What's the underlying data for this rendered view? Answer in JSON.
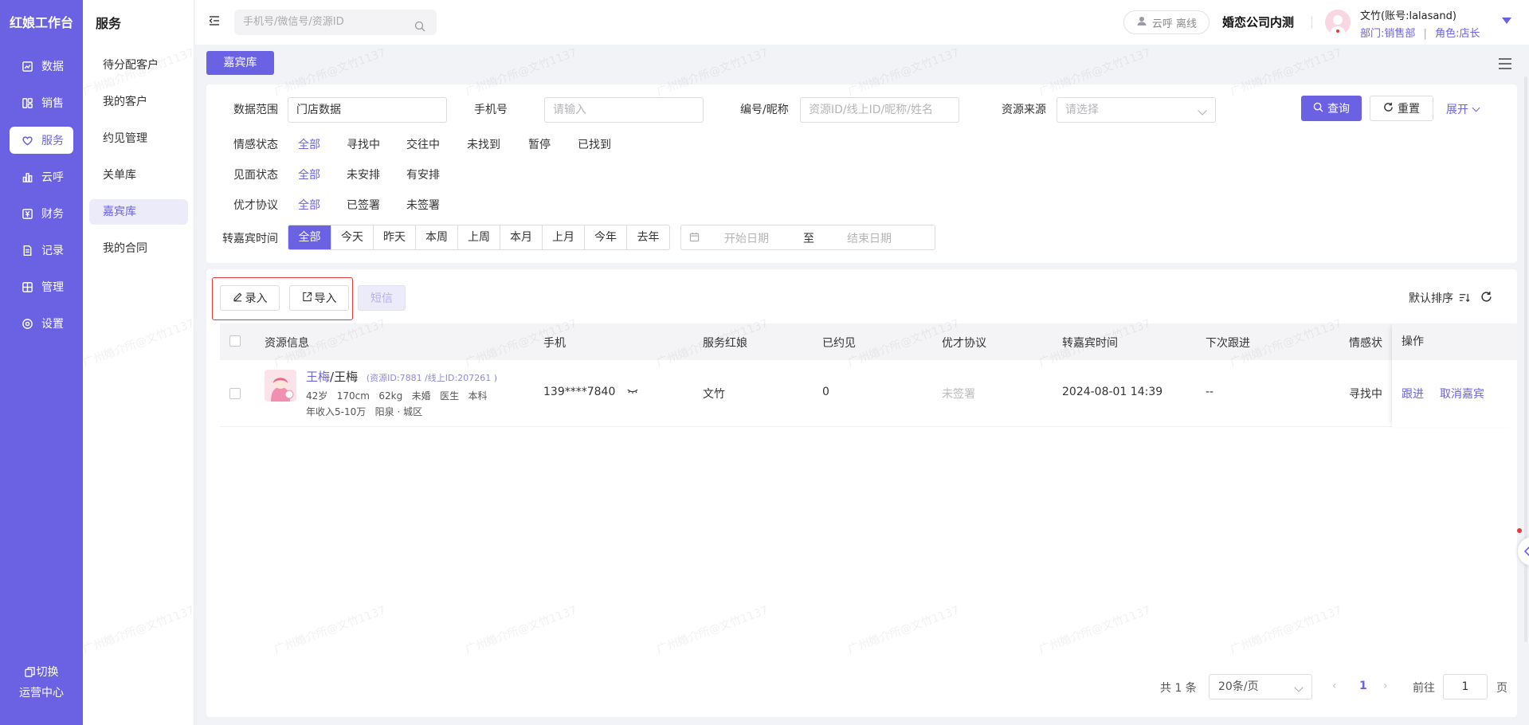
{
  "app": {
    "brand": "红娘工作台"
  },
  "sidebar": {
    "items": [
      {
        "label": "数据",
        "icon": "chart-icon"
      },
      {
        "label": "销售",
        "icon": "layout-icon"
      },
      {
        "label": "服务",
        "icon": "heart-icon",
        "active": true
      },
      {
        "label": "云呼",
        "icon": "bar-chart-icon"
      },
      {
        "label": "财务",
        "icon": "yen-icon"
      },
      {
        "label": "记录",
        "icon": "document-icon"
      },
      {
        "label": "管理",
        "icon": "grid-icon"
      },
      {
        "label": "设置",
        "icon": "settings-icon"
      }
    ],
    "switch_line1": "切换",
    "switch_line2": "运营中心"
  },
  "subnav": {
    "title": "服务",
    "items": [
      {
        "label": "待分配客户"
      },
      {
        "label": "我的客户"
      },
      {
        "label": "约见管理"
      },
      {
        "label": "关单库"
      },
      {
        "label": "嘉宾库",
        "active": true
      },
      {
        "label": "我的合同"
      }
    ]
  },
  "header": {
    "search_placeholder": "手机号/微信号/资源ID",
    "cloud_status": "云呼 离线",
    "company": "婚恋公司内测",
    "user_name": "文竹(账号:lalasand)",
    "user_dept": "部门:销售部",
    "user_sep": "|",
    "user_role": "角色:店长"
  },
  "tabs": {
    "active": "嘉宾库"
  },
  "filters": {
    "scope_label": "数据范围",
    "scope_value": "门店数据",
    "phone_label": "手机号",
    "phone_placeholder": "请输入",
    "code_label": "编号/昵称",
    "code_placeholder": "资源ID/线上ID/昵称/姓名",
    "source_label": "资源来源",
    "source_placeholder": "请选择",
    "query_label": "查询",
    "reset_label": "重置",
    "expand_label": "展开",
    "emotion_label": "情感状态",
    "emotion_options": [
      "全部",
      "寻找中",
      "交往中",
      "未找到",
      "暂停",
      "已找到"
    ],
    "meet_label": "见面状态",
    "meet_options": [
      "全部",
      "未安排",
      "有安排"
    ],
    "agreement_label": "优才协议",
    "agreement_options": [
      "全部",
      "已签署",
      "未签署"
    ],
    "transfer_label": "转嘉宾时间",
    "transfer_options": [
      "全部",
      "今天",
      "昨天",
      "本周",
      "上周",
      "本月",
      "上月",
      "今年",
      "去年"
    ],
    "date_start": "开始日期",
    "date_to": "至",
    "date_end": "结束日期"
  },
  "toolbar": {
    "enter_label": "录入",
    "import_label": "导入",
    "sms_label": "短信",
    "sort_label": "默认排序"
  },
  "table": {
    "columns": [
      "资源信息",
      "手机",
      "服务红娘",
      "已约见",
      "优才协议",
      "转嘉宾时间",
      "下次跟进",
      "情感状",
      "操作"
    ],
    "rows": [
      {
        "name_link": "王梅",
        "name_sep": "/",
        "name_plain": "王梅",
        "ids": "(资源ID:7881 /线上ID:207261 )",
        "line1": "42岁   170cm   62kg   未婚   医生   本科",
        "line2": "年收入5-10万   阳泉 · 城区",
        "phone": "139****7840",
        "matchmaker": "文竹",
        "met": "0",
        "agreement": "未签署",
        "transfer_time": "2024-08-01 14:39",
        "next_follow": "--",
        "emotion": "寻找中",
        "action_follow": "跟进",
        "action_cancel": "取消嘉宾"
      }
    ]
  },
  "pagination": {
    "total": "共 1 条",
    "page_size": "20条/页",
    "current": "1",
    "goto_label": "前往",
    "goto_value": "1",
    "page_suffix": "页"
  },
  "watermark": "广州婚介所@文竹1137",
  "colors": {
    "primary": "#6b62e3",
    "highlight": "#e4393c"
  }
}
